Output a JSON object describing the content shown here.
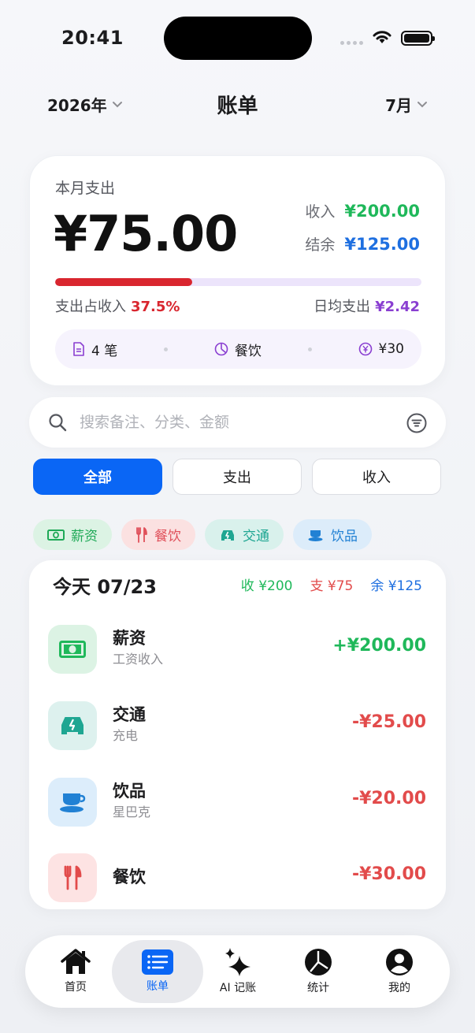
{
  "status": {
    "time": "20:41"
  },
  "nav": {
    "year": "2026年",
    "title": "账单",
    "month": "7月"
  },
  "summary": {
    "label": "本月支出",
    "amount": "¥75.00",
    "income_label": "收入",
    "income_value": "¥200.00",
    "balance_label": "结余",
    "balance_value": "¥125.00",
    "progress_fraction": 0.375,
    "ratio_label": "支出占收入",
    "ratio_value": "37.5%",
    "avg_label": "日均支出",
    "avg_value": "¥2.42",
    "stats": [
      {
        "icon": "document-icon",
        "text": "4 笔"
      },
      {
        "icon": "pie-chart-icon",
        "text": "餐饮"
      },
      {
        "icon": "yen-coin-icon",
        "text": "¥30"
      }
    ]
  },
  "search": {
    "placeholder": "搜索备注、分类、金额"
  },
  "filters": [
    "全部",
    "支出",
    "收入"
  ],
  "chips": [
    "薪资",
    "餐饮",
    "交通",
    "饮品"
  ],
  "day": {
    "title": "今天 07/23",
    "income": "收 ¥200",
    "expense": "支 ¥75",
    "balance": "余 ¥125",
    "transactions": [
      {
        "category": "薪资",
        "note": "工资收入",
        "amount": "+¥200.00",
        "color": "#1fb85a"
      },
      {
        "category": "交通",
        "note": "充电",
        "amount": "-¥25.00",
        "color": "#e24b4b"
      },
      {
        "category": "饮品",
        "note": "星巴克",
        "amount": "-¥20.00",
        "color": "#e24b4b"
      },
      {
        "category": "餐饮",
        "note": "",
        "amount": "-¥30.00",
        "color": "#e24b4b"
      }
    ]
  },
  "tabs": [
    "首页",
    "账单",
    "AI 记账",
    "统计",
    "我的"
  ],
  "colors": {
    "accent": "#0a66f5",
    "income": "#1fb85a",
    "expense": "#e24b4b",
    "balance": "#1e6fe0"
  }
}
